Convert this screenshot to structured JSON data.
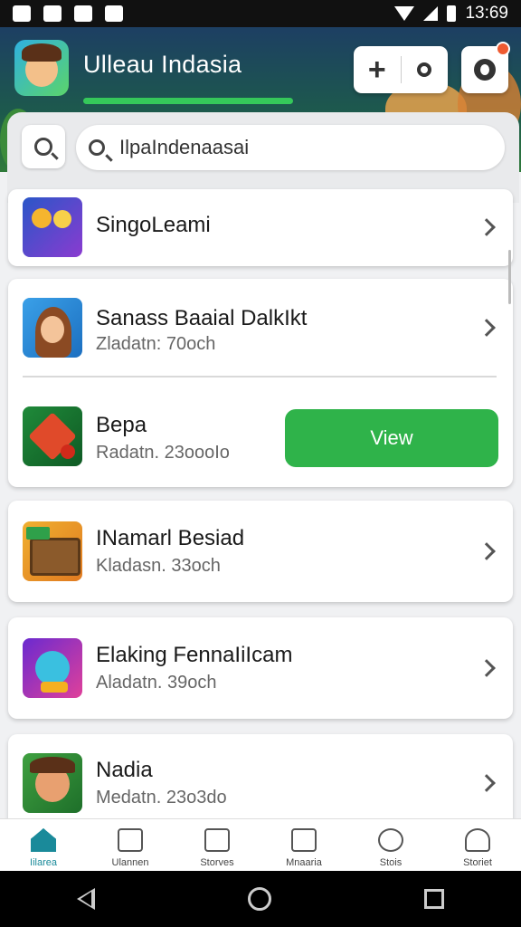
{
  "status_bar": {
    "time": "13:69"
  },
  "header": {
    "title": "Ulleau Indasia"
  },
  "search": {
    "placeholder": "",
    "value": "IlpaIndenaasai"
  },
  "items": [
    {
      "name": "SingoLeami",
      "subtitle": "",
      "icon": "cartoon-sun-icon"
    },
    {
      "name": "Sanass Baaial DalkIkt",
      "subtitle": "Zladatn: 70och",
      "icon": "girl-avatar-icon"
    },
    {
      "name": "Bepa",
      "subtitle": "Radatn. 23oooIo",
      "icon": "compass-game-icon",
      "action": "View"
    },
    {
      "name": "INamarl Besiad",
      "subtitle": "Kladasn. 33och",
      "icon": "treasure-chest-icon"
    },
    {
      "name": "Elaking FennaIiIcam",
      "subtitle": "Aladatn. 39och",
      "icon": "monster-game-icon"
    },
    {
      "name": "Nadia",
      "subtitle": "Medatn. 23o3do",
      "icon": "boy-avatar-icon"
    }
  ],
  "tabs": [
    {
      "label": "Iilarea",
      "active": true
    },
    {
      "label": "Ulannen",
      "active": false
    },
    {
      "label": "Storves",
      "active": false
    },
    {
      "label": "Mnaaria",
      "active": false
    },
    {
      "label": "Stois",
      "active": false
    },
    {
      "label": "Storiet",
      "active": false
    }
  ],
  "colors": {
    "accent_green": "#2fb34a",
    "active_tab": "#1a8a9a",
    "header_top": "#1d3f63"
  }
}
